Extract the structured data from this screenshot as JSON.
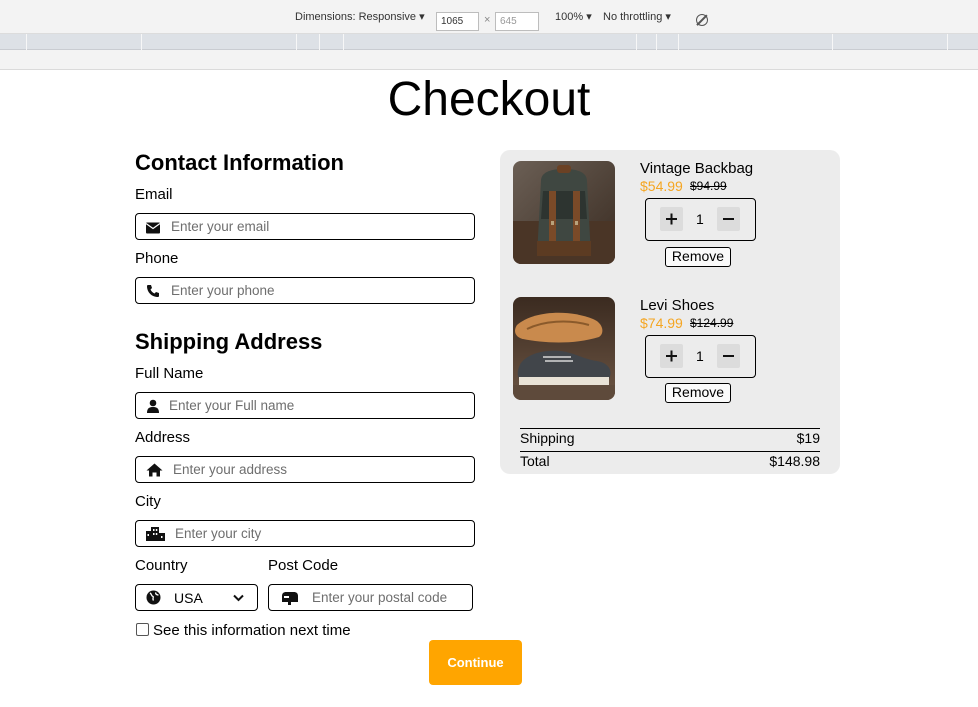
{
  "devtools": {
    "dimensions_label": "Dimensions: Responsive",
    "width_value": "1065",
    "times_symbol": "×",
    "height_value": "645",
    "zoom": "100%",
    "throttling": "No throttling"
  },
  "page": {
    "title": "Checkout"
  },
  "contact": {
    "heading": "Contact Information",
    "email_label": "Email",
    "email_placeholder": "Enter your email",
    "phone_label": "Phone",
    "phone_placeholder": "Enter your phone"
  },
  "shipping": {
    "heading": "Shipping Address",
    "fullname_label": "Full Name",
    "fullname_placeholder": "Enter your Full name",
    "address_label": "Address",
    "address_placeholder": "Enter your address",
    "city_label": "City",
    "city_placeholder": "Enter your city",
    "country_label": "Country",
    "country_value": "USA",
    "postcode_label": "Post Code",
    "postcode_placeholder": "Enter your postal code",
    "save_info_label": "See this information next time",
    "save_info_checked": false,
    "continue_label": "Continue"
  },
  "cart": {
    "items": [
      {
        "name": "Vintage Backbag",
        "price": "$54.99",
        "old_price": "$94.99",
        "quantity": "1",
        "remove_label": "Remove",
        "image": "backpack-photo"
      },
      {
        "name": "Levi Shoes",
        "price": "$74.99",
        "old_price": "$124.99",
        "quantity": "1",
        "remove_label": "Remove",
        "image": "shoe-photo"
      }
    ],
    "shipping_label": "Shipping",
    "shipping_value": "$19",
    "total_label": "Total",
    "total_value": "$148.98"
  },
  "colors": {
    "accent": "#ffa500",
    "price": "#f5a623",
    "cart_background": "#ececec"
  }
}
